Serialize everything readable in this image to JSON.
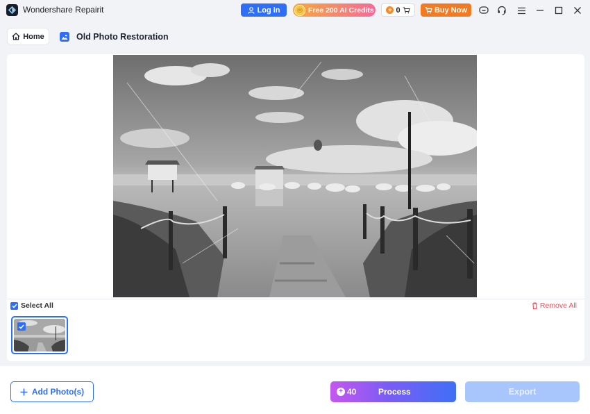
{
  "app": {
    "name": "Wondershare Repairit",
    "icon": "repairit-logo-icon"
  },
  "titlebar": {
    "login_label": "Log in",
    "credits_label": "Free 200 AI Credits",
    "cart_count": "0",
    "buy_label": "Buy Now",
    "icons": [
      "chat-icon",
      "headset-support-icon",
      "menu-icon",
      "minimize-icon",
      "maximize-icon",
      "close-icon"
    ]
  },
  "breadcrumb": {
    "home_label": "Home",
    "page_title": "Old Photo Restoration"
  },
  "gallery": {
    "select_all_label": "Select All",
    "select_all_checked": true,
    "remove_all_label": "Remove All",
    "thumbnails": [
      {
        "selected": true
      }
    ]
  },
  "actions": {
    "add_label": "Add Photo(s)",
    "process_cost": "40",
    "process_label": "Process",
    "export_label": "Export"
  },
  "colors": {
    "accent": "#2f6ff7",
    "buy": "#f27a21",
    "danger": "#e8505b",
    "export_disabled": "#a8c6fb"
  }
}
